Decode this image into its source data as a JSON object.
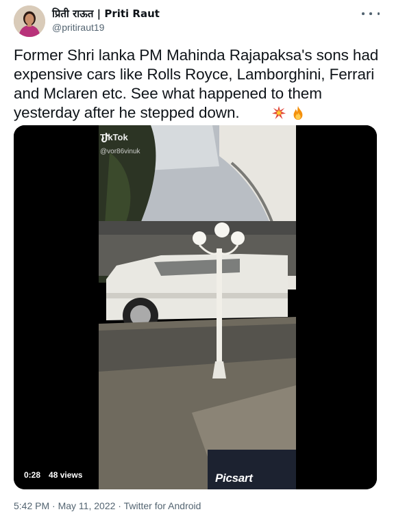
{
  "author": {
    "display_name": "प्रिती राऊत | Priti Raut",
    "handle": "@pritiraut19",
    "avatar_icon": "profile-photo"
  },
  "menu": {
    "more_icon": "ellipsis-icon"
  },
  "tweet": {
    "text": "Former Shri lanka PM Mahinda Rajapaksa's sons had expensive cars like Rolls Royce, Lamborghini, Ferrari and Mclaren etc. See what happened to them yesterday after he stepped down.",
    "emojis": [
      "collision-emoji",
      "fire-emoji"
    ]
  },
  "video": {
    "watermark_brand": "TikTok",
    "watermark_handle": "@vor86vinuk",
    "duration": "0:28",
    "views": "48 views",
    "editor_watermark": "Picsart"
  },
  "footer": {
    "time": "5:42 PM",
    "date": "May 11, 2022",
    "client": "Twitter for Android",
    "separator": "·"
  },
  "colors": {
    "muted": "#536471",
    "text": "#0f1419",
    "background": "#ffffff"
  }
}
